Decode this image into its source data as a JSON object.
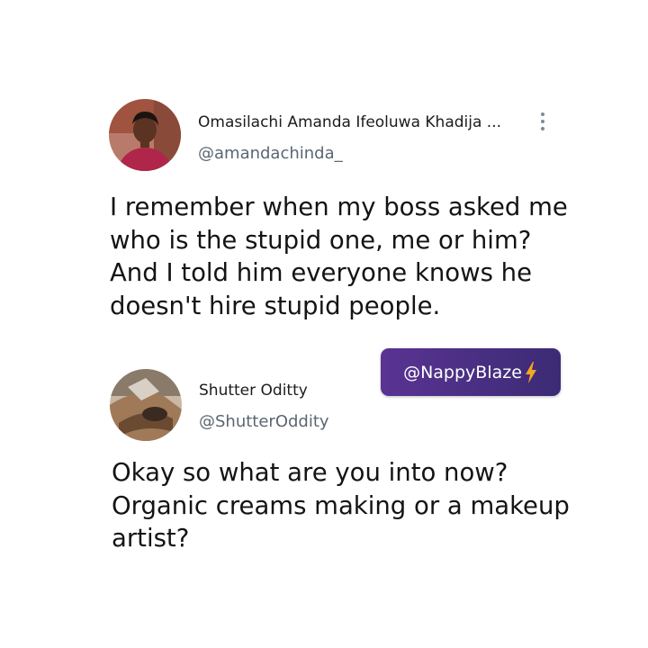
{
  "tweet": {
    "author": {
      "display_name": "Omasilachi Amanda Ifeoluwa Khadija ...",
      "handle": "@amandachinda_",
      "avatar_icon": "profile-photo"
    },
    "text_lines": [
      "I remember when my boss asked me",
      "who is the stupid one, me or him?",
      "And I told him everyone knows he",
      "doesn't hire stupid people."
    ],
    "menu_icon": "more-vertical-icon"
  },
  "reply": {
    "author": {
      "display_name": "Shutter Oditty",
      "handle": "@ShutterOddity",
      "avatar_icon": "profile-photo"
    },
    "text_lines": [
      "Okay so what are you into now?",
      "Organic creams making or a makeup",
      "artist?"
    ]
  },
  "watermark": {
    "text": "@NappyBlaze",
    "icon": "lightning-bolt-icon"
  },
  "colors": {
    "handle": "#5b6671",
    "text": "#141414",
    "menu_dots": "#7a8c99",
    "watermark_start": "#5a3393",
    "watermark_end": "#3b2b74",
    "bolt": "#f5a623"
  }
}
